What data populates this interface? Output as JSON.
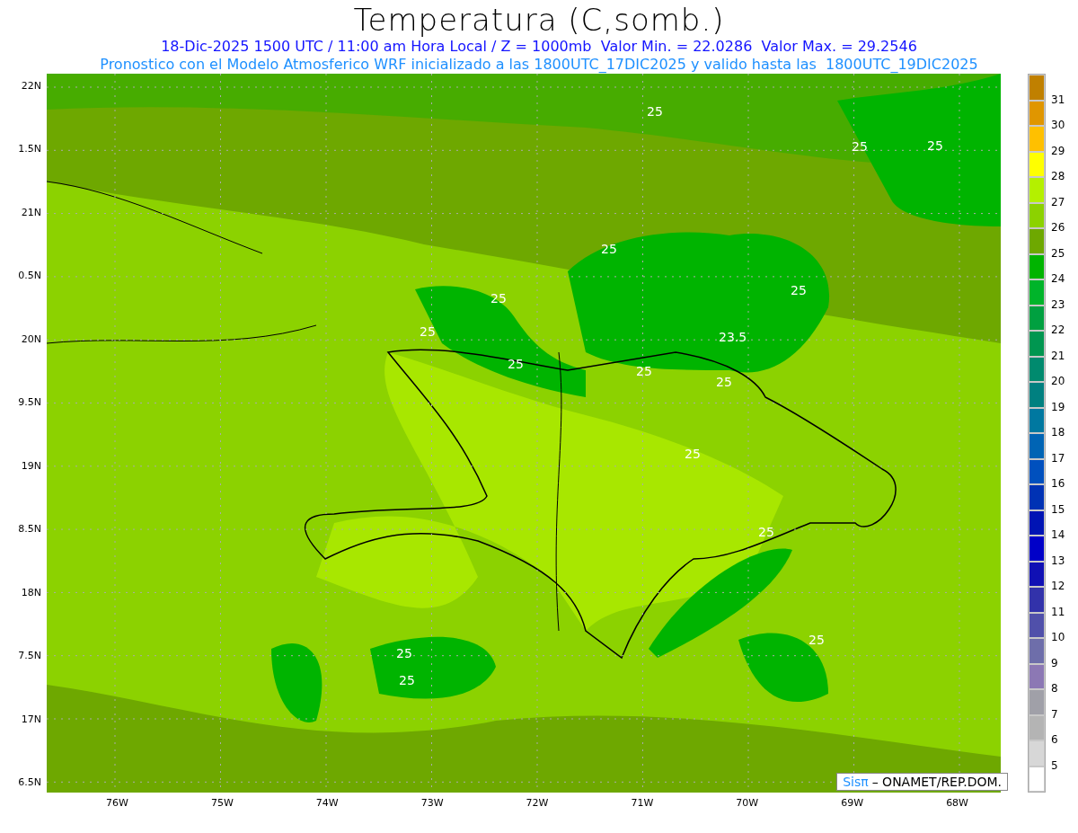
{
  "title": "Temperatura (C,somb.)",
  "subtitle": "18-Dic-2025 1500 UTC / 11:00 am Hora Local / Z = 1000mb  Valor Min. = 22.0286  Valor Max. = 29.2546",
  "note": "Pronostico con el Modelo Atmosferico WRF inicializado a las 1800UTC_17DIC2025 y valido hasta las  1800UTC_19DIC2025",
  "y_ticks": [
    "22N",
    "1.5N",
    "21N",
    "0.5N",
    "20N",
    "9.5N",
    "19N",
    "8.5N",
    "18N",
    "7.5N",
    "17N",
    "6.5N"
  ],
  "x_ticks": [
    "76W",
    "75W",
    "74W",
    "73W",
    "72W",
    "71W",
    "70W",
    "69W",
    "68W"
  ],
  "contour_labels": [
    "25",
    "25",
    "25",
    "25",
    "25",
    "25",
    "25",
    "23.5",
    "25",
    "25",
    "25",
    "25",
    "25",
    "25",
    "25",
    "25"
  ],
  "colorbar": [
    {
      "color": "#c08000",
      "label": "31"
    },
    {
      "color": "#e09600",
      "label": "30"
    },
    {
      "color": "#ffc000",
      "label": "29"
    },
    {
      "color": "#ffff00",
      "label": "28"
    },
    {
      "color": "#b4f000",
      "label": "27"
    },
    {
      "color": "#8cd200",
      "label": "26"
    },
    {
      "color": "#6ea800",
      "label": "25"
    },
    {
      "color": "#00b400",
      "label": "24"
    },
    {
      "color": "#00b42a",
      "label": "23"
    },
    {
      "color": "#00a040",
      "label": "22"
    },
    {
      "color": "#009650",
      "label": "21"
    },
    {
      "color": "#008a6e",
      "label": "20"
    },
    {
      "color": "#008080",
      "label": "19"
    },
    {
      "color": "#0078a0",
      "label": "18"
    },
    {
      "color": "#0064b4",
      "label": "17"
    },
    {
      "color": "#0050be",
      "label": "16"
    },
    {
      "color": "#0032b4",
      "label": "15"
    },
    {
      "color": "#0014b4",
      "label": "14"
    },
    {
      "color": "#0000c8",
      "label": "13"
    },
    {
      "color": "#1010b4",
      "label": "12"
    },
    {
      "color": "#3232aa",
      "label": "11"
    },
    {
      "color": "#5050aa",
      "label": "10"
    },
    {
      "color": "#6e6eaa",
      "label": "9"
    },
    {
      "color": "#8c78b4",
      "label": "8"
    },
    {
      "color": "#a0a0a8",
      "label": "7"
    },
    {
      "color": "#b4b4b4",
      "label": "6"
    },
    {
      "color": "#d7d7d7",
      "label": "5"
    },
    {
      "color": "#ffffff"
    }
  ],
  "logo": {
    "brand": "Sis",
    "symbol": "π",
    "credit": "– ONAMET/REP.DOM."
  }
}
